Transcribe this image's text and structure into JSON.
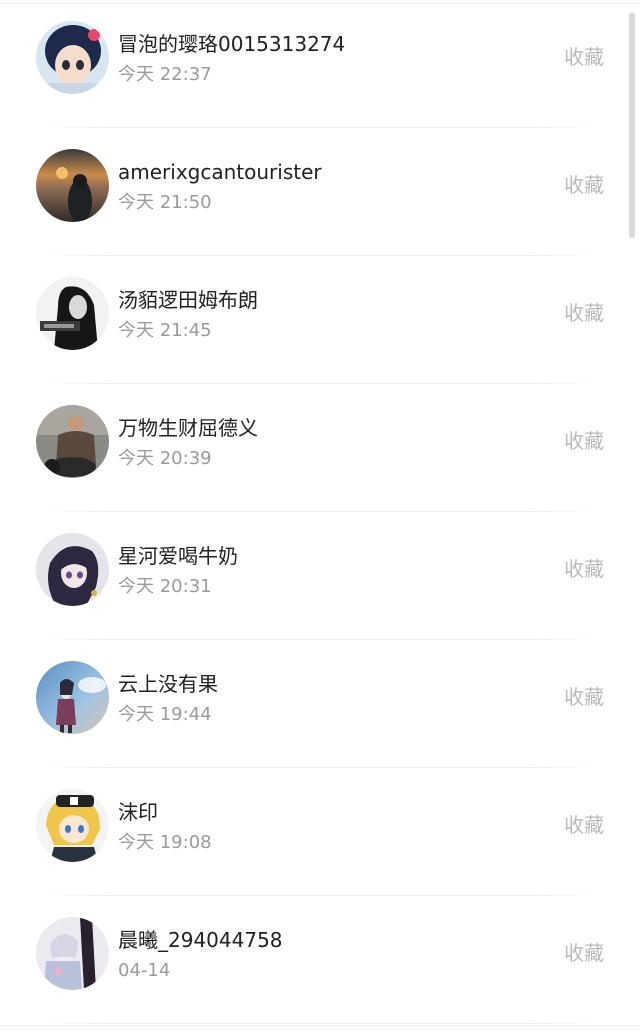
{
  "list": {
    "items": [
      {
        "name": "冒泡的璎珞0015313274",
        "time": "今天 22:37",
        "action": "收藏"
      },
      {
        "name": "amerixgcantourister",
        "time": "今天 21:50",
        "action": "收藏"
      },
      {
        "name": "汤貊逻田姆布朗",
        "time": "今天 21:45",
        "action": "收藏"
      },
      {
        "name": "万物生财屈德义",
        "time": "今天 20:39",
        "action": "收藏"
      },
      {
        "name": "星河爱喝牛奶",
        "time": "今天 20:31",
        "action": "收藏"
      },
      {
        "name": "云上没有果",
        "time": "今天 19:44",
        "action": "收藏"
      },
      {
        "name": "沫印",
        "time": "今天 19:08",
        "action": "收藏"
      },
      {
        "name": "晨曦_294044758",
        "time": "04-14",
        "action": "收藏"
      }
    ]
  },
  "colors": {
    "name_text": "#222222",
    "time_text": "#9a9a9a",
    "action_text": "#b9b9b9",
    "divider": "#ececec"
  }
}
